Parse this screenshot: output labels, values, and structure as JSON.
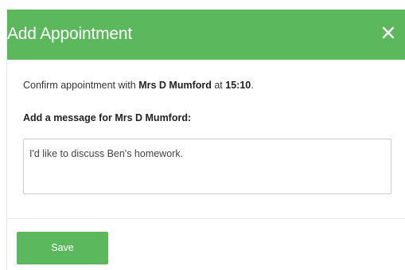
{
  "dialog": {
    "title": "Add Appointment",
    "close_icon": "close-icon",
    "accent_color": "#5cb85c"
  },
  "body": {
    "confirm_prefix": "Confirm appointment with ",
    "teacher_name": "Mrs D Mumford",
    "confirm_middle": " at ",
    "time": "15:10",
    "confirm_suffix": ".",
    "message_label": "Add a message for Mrs D Mumford:",
    "message_value": "I'd like to discuss Ben's homework."
  },
  "footer": {
    "save_label": "Save"
  }
}
